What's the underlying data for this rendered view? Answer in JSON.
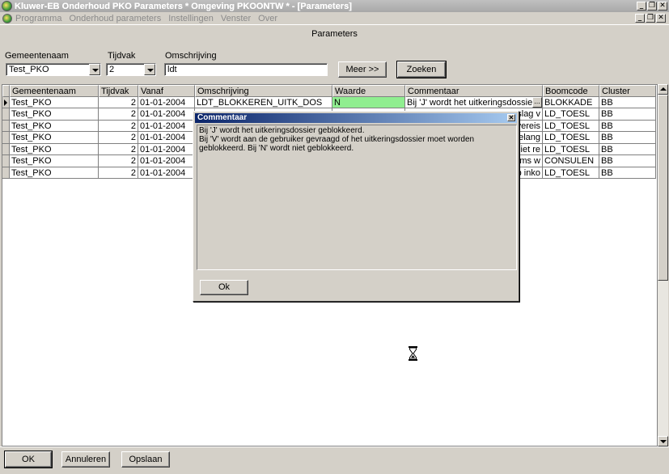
{
  "window": {
    "title": "Kluwer-EB Onderhoud PKO Parameters * Omgeving PKOONTW * - [Parameters]",
    "minimize_glyph": "_",
    "restore_glyph": "❐",
    "close_glyph": "✕"
  },
  "menu": {
    "items": [
      "Programma",
      "Onderhoud parameters",
      "Instellingen",
      "Venster",
      "Over"
    ]
  },
  "form": {
    "title": "Parameters"
  },
  "filters": {
    "gemeente_label": "Gemeentenaam",
    "gemeente_value": "Test_PKO",
    "tijdvak_label": "Tijdvak",
    "tijdvak_value": "2",
    "omschrijving_label": "Omschrijving",
    "omschrijving_value": "ldt",
    "meer_label": "Meer >>",
    "zoeken_label": "Zoeken"
  },
  "grid": {
    "columns": [
      "Gemeentenaam",
      "Tijdvak",
      "Vanaf",
      "Omschrijving",
      "Waarde",
      "Commentaar",
      "Boomcode",
      "Cluster"
    ],
    "rows": [
      {
        "gemeente": "Test_PKO",
        "tijdvak": "2",
        "vanaf": "01-01-2004",
        "omschrijving": "LDT_BLOKKEREN_UITK_DOS",
        "waarde": "N",
        "commentaar": "Bij 'J' wordt het uitkeringsdossier geblokk",
        "boomcode": "BLOKKADE",
        "cluster": "BB"
      },
      {
        "gemeente": "Test_PKO",
        "tijdvak": "2",
        "vanaf": "01-01-2004",
        "omschrijving": "",
        "waarde": "",
        "commentaar": "slag v",
        "boomcode": "LD_TOESL",
        "cluster": "BB"
      },
      {
        "gemeente": "Test_PKO",
        "tijdvak": "2",
        "vanaf": "01-01-2004",
        "omschrijving": "",
        "waarde": "",
        "commentaar": "t vereis",
        "boomcode": "LD_TOESL",
        "cluster": "BB"
      },
      {
        "gemeente": "Test_PKO",
        "tijdvak": "2",
        "vanaf": "01-01-2004",
        "omschrijving": "",
        "waarde": "",
        "commentaar": "belang",
        "boomcode": "LD_TOESL",
        "cluster": "BB"
      },
      {
        "gemeente": "Test_PKO",
        "tijdvak": "2",
        "vanaf": "01-01-2004",
        "omschrijving": "",
        "waarde": "",
        "commentaar": "t niet re",
        "boomcode": "LD_TOESL",
        "cluster": "BB"
      },
      {
        "gemeente": "Test_PKO",
        "tijdvak": "2",
        "vanaf": "01-01-2004",
        "omschrijving": "",
        "waarde": "",
        "commentaar": "tems w",
        "boomcode": "CONSULEN",
        "cluster": "BB"
      },
      {
        "gemeente": "Test_PKO",
        "tijdvak": "2",
        "vanaf": "01-01-2004",
        "omschrijving": "",
        "waarde": "",
        "commentaar": "op inko",
        "boomcode": "LD_TOESL",
        "cluster": "BB"
      }
    ],
    "ellipsis_label": "..."
  },
  "dialog": {
    "title": "Commentaar",
    "line1": "Bij 'J' wordt het uitkeringsdossier geblokkeerd.",
    "line2": "Bij 'V' wordt aan de gebruiker gevraagd of het uitkeringsdossier moet worden geblokkeerd. Bij 'N' wordt niet geblokkeerd.",
    "ok_label": "Ok"
  },
  "buttons": {
    "ok": "OK",
    "annuleren": "Annuleren",
    "opslaan": "Opslaan"
  }
}
